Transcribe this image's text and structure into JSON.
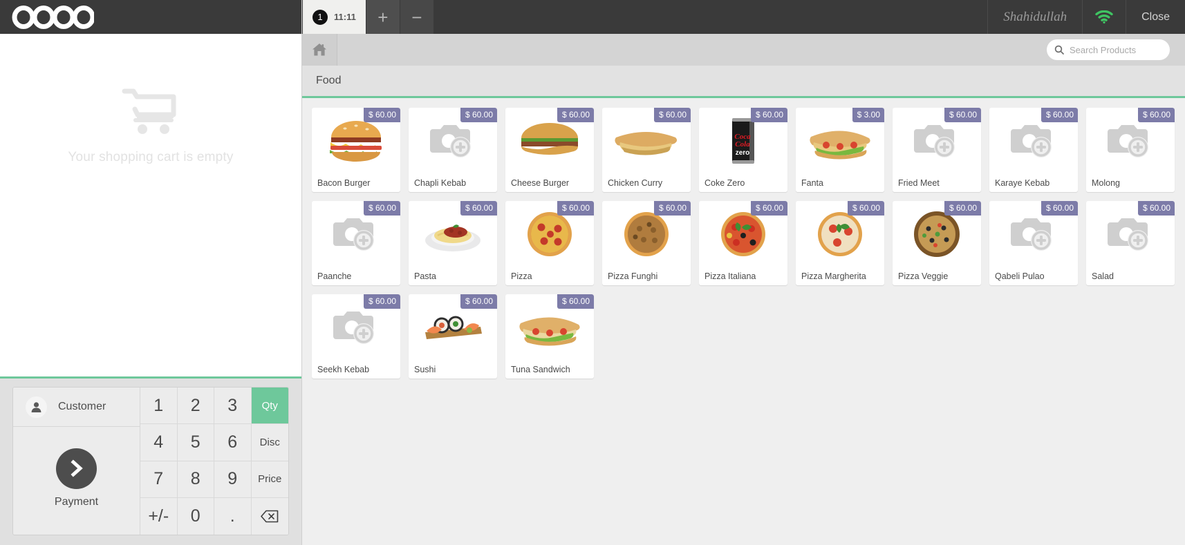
{
  "brand": {
    "name": "odoo"
  },
  "cart": {
    "empty_message": "Your shopping cart is empty",
    "icon": "shopping-cart-icon"
  },
  "numpad": {
    "customer_label": "Customer",
    "customer_icon": "user-icon",
    "payment_label": "Payment",
    "payment_icon": "chevron-right-icon",
    "keys": [
      {
        "label": "1",
        "name": "numpad-key-1",
        "mode": false,
        "active": false
      },
      {
        "label": "2",
        "name": "numpad-key-2",
        "mode": false,
        "active": false
      },
      {
        "label": "3",
        "name": "numpad-key-3",
        "mode": false,
        "active": false
      },
      {
        "label": "Qty",
        "name": "numpad-qty-button",
        "mode": true,
        "active": true
      },
      {
        "label": "4",
        "name": "numpad-key-4",
        "mode": false,
        "active": false
      },
      {
        "label": "5",
        "name": "numpad-key-5",
        "mode": false,
        "active": false
      },
      {
        "label": "6",
        "name": "numpad-key-6",
        "mode": false,
        "active": false
      },
      {
        "label": "Disc",
        "name": "numpad-disc-button",
        "mode": true,
        "active": false
      },
      {
        "label": "7",
        "name": "numpad-key-7",
        "mode": false,
        "active": false
      },
      {
        "label": "8",
        "name": "numpad-key-8",
        "mode": false,
        "active": false
      },
      {
        "label": "9",
        "name": "numpad-key-9",
        "mode": false,
        "active": false
      },
      {
        "label": "Price",
        "name": "numpad-price-button",
        "mode": true,
        "active": false
      },
      {
        "label": "+/-",
        "name": "numpad-sign-button",
        "mode": false,
        "active": false
      },
      {
        "label": "0",
        "name": "numpad-key-0",
        "mode": false,
        "active": false
      },
      {
        "label": ".",
        "name": "numpad-decimal-button",
        "mode": false,
        "active": false
      },
      {
        "label": "",
        "name": "numpad-backspace-button",
        "mode": false,
        "active": false,
        "icon": "backspace-icon"
      }
    ]
  },
  "header": {
    "order_tab": {
      "number": "1",
      "time": "11:11"
    },
    "add_order_label": "+",
    "remove_order_label": "−",
    "user_name": "Shahidullah",
    "wifi_icon": "wifi-icon",
    "close_label": "Close"
  },
  "breadcrumb": {
    "home_icon": "home-icon"
  },
  "search": {
    "placeholder": "Search Products",
    "value": "",
    "icon": "search-icon",
    "clear_icon": "close-icon"
  },
  "categories": [
    {
      "label": "Food",
      "active": true
    }
  ],
  "colors": {
    "accent_green": "#6ec89b",
    "price_badge": "#7c7ba8",
    "header_dark": "#3a3a3a",
    "grid_bg": "#efefef"
  },
  "products": [
    {
      "name": "Bacon Burger",
      "price": "$ 60.00",
      "image": "bacon-burger"
    },
    {
      "name": "Chapli Kebab",
      "price": "$ 60.00",
      "image": "placeholder"
    },
    {
      "name": "Cheese Burger",
      "price": "$ 60.00",
      "image": "cheese-burger"
    },
    {
      "name": "Chicken Curry",
      "price": "$ 60.00",
      "image": "chicken-curry"
    },
    {
      "name": "Coke Zero",
      "price": "$ 60.00",
      "image": "coke-zero"
    },
    {
      "name": "Fanta",
      "price": "$ 3.00",
      "image": "fanta-sandwich"
    },
    {
      "name": "Fried Meet",
      "price": "$ 60.00",
      "image": "placeholder"
    },
    {
      "name": "Karaye Kebab",
      "price": "$ 60.00",
      "image": "placeholder"
    },
    {
      "name": "Molong",
      "price": "$ 60.00",
      "image": "placeholder"
    },
    {
      "name": "Paanche",
      "price": "$ 60.00",
      "image": "placeholder"
    },
    {
      "name": "Pasta",
      "price": "$ 60.00",
      "image": "pasta"
    },
    {
      "name": "Pizza",
      "price": "$ 60.00",
      "image": "pizza"
    },
    {
      "name": "Pizza Funghi",
      "price": "$ 60.00",
      "image": "pizza-funghi"
    },
    {
      "name": "Pizza Italiana",
      "price": "$ 60.00",
      "image": "pizza-italiana"
    },
    {
      "name": "Pizza Margherita",
      "price": "$ 60.00",
      "image": "pizza-margherita"
    },
    {
      "name": "Pizza Veggie",
      "price": "$ 60.00",
      "image": "pizza-veggie"
    },
    {
      "name": "Qabeli Pulao",
      "price": "$ 60.00",
      "image": "placeholder"
    },
    {
      "name": "Salad",
      "price": "$ 60.00",
      "image": "placeholder"
    },
    {
      "name": "Seekh Kebab",
      "price": "$ 60.00",
      "image": "placeholder"
    },
    {
      "name": "Sushi",
      "price": "$ 60.00",
      "image": "sushi"
    },
    {
      "name": "Tuna Sandwich",
      "price": "$ 60.00",
      "image": "tuna-sandwich"
    }
  ]
}
